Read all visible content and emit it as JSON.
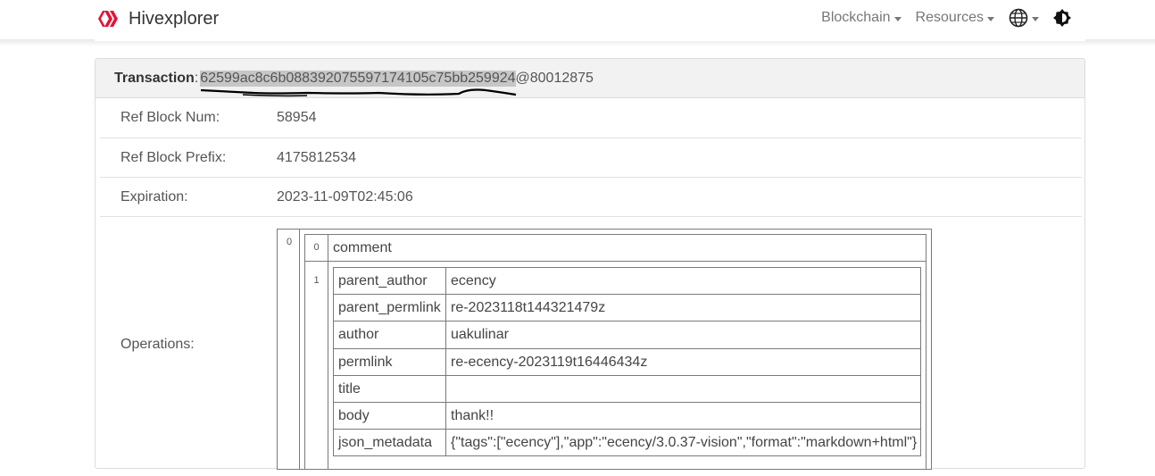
{
  "nav": {
    "brand": "Hivexplorer",
    "blockchain": "Blockchain",
    "resources": "Resources"
  },
  "colors": {
    "brand_red": "#e31337",
    "accent_grey": "#777777"
  },
  "transaction": {
    "label": "Transaction",
    "colon": ":",
    "hash": "62599ac8c6b088392075597174105c75bb259924",
    "suffix": "@80012875"
  },
  "rows": [
    {
      "label": "Ref Block Num:",
      "value": "58954"
    },
    {
      "label": "Ref Block Prefix:",
      "value": "4175812534"
    },
    {
      "label": "Expiration:",
      "value": "2023-11-09T02:45:06"
    },
    {
      "label": "Operations:",
      "value": ""
    }
  ],
  "operations": {
    "outer_index": "0",
    "inner_index_0": "0",
    "inner_index_1": "1",
    "op_type": "comment",
    "fields": [
      {
        "key": "parent_author",
        "value": "ecency"
      },
      {
        "key": "parent_permlink",
        "value": "re-2023118t144321479z"
      },
      {
        "key": "author",
        "value": "uakulinar"
      },
      {
        "key": "permlink",
        "value": "re-ecency-2023119t16446434z"
      },
      {
        "key": "title",
        "value": ""
      },
      {
        "key": "body",
        "value": "thank!!"
      },
      {
        "key": "json_metadata",
        "value": "{\"tags\":[\"ecency\"],\"app\":\"ecency/3.0.37-vision\",\"format\":\"markdown+html\"}"
      }
    ]
  }
}
